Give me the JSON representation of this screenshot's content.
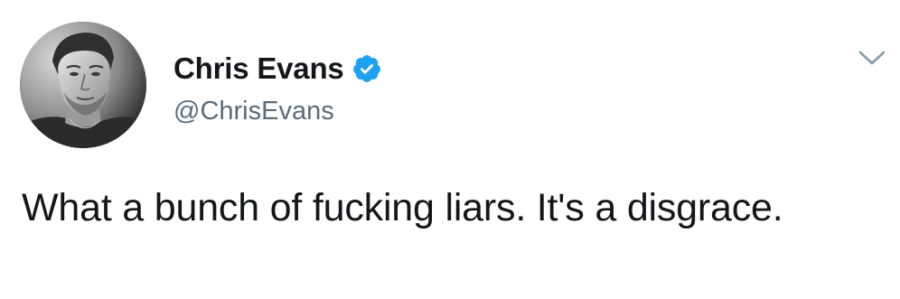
{
  "tweet": {
    "author": {
      "display_name": "Chris Evans",
      "handle": "@ChrisEvans",
      "verified": true
    },
    "text": "What a bunch of fucking liars. It's a disgrace.",
    "icons": {
      "verified": "verified-badge-icon",
      "menu": "chevron-down-icon",
      "avatar": "profile-photo"
    },
    "colors": {
      "verified_badge": "#1da1f2",
      "handle": "#5b6b78",
      "text": "#14171a",
      "caret": "#8899a6"
    }
  }
}
